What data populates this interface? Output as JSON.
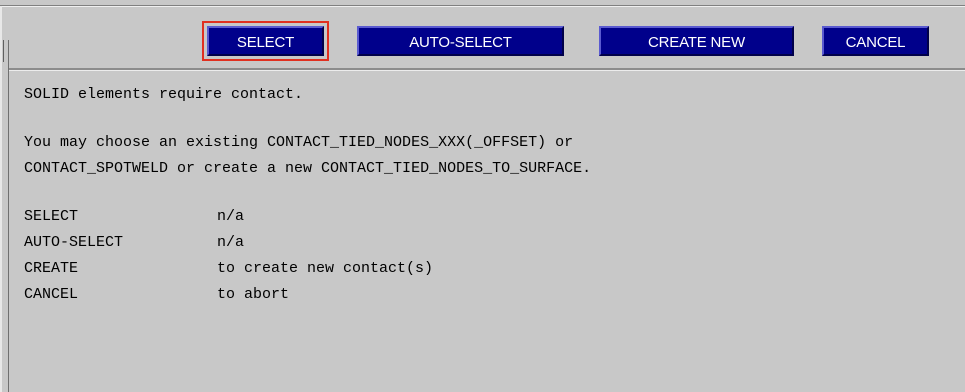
{
  "toolbar": {
    "buttons": [
      {
        "label": "SELECT",
        "highlighted": true
      },
      {
        "label": "AUTO-SELECT"
      },
      {
        "label": "CREATE NEW"
      },
      {
        "label": "CANCEL"
      }
    ],
    "button_color": "#00008b",
    "highlight_color": "#e03020"
  },
  "message": {
    "line1": "SOLID elements require contact.",
    "line2": "You may choose an existing CONTACT_TIED_NODES_XXX(_OFFSET) or",
    "line3": "CONTACT_SPOTWELD or create a new CONTACT_TIED_NODES_TO_SURFACE.",
    "options": [
      {
        "key": "SELECT",
        "desc": "n/a"
      },
      {
        "key": "AUTO-SELECT",
        "desc": "n/a"
      },
      {
        "key": "CREATE",
        "desc": "to create new contact(s)"
      },
      {
        "key": "CANCEL",
        "desc": "to abort"
      }
    ]
  }
}
